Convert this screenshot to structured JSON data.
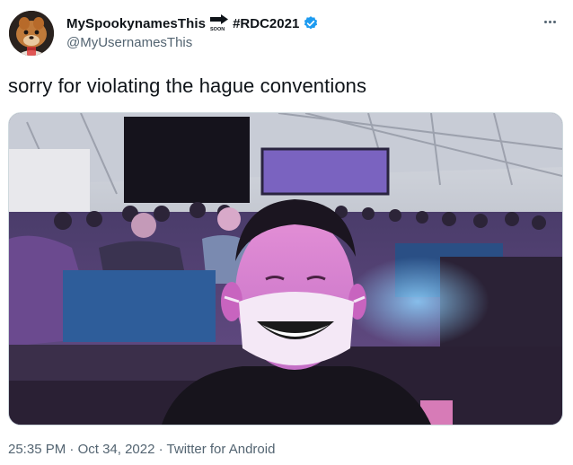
{
  "tweet": {
    "display_name": "MySpookynamesThis",
    "soon_label": "SOON",
    "hashtag": "#RDC2021",
    "username": "@MyUsernamesThis",
    "text": "sorry for violating the hague conventions",
    "time": "25:35 PM",
    "separator": "·",
    "date": "Oct 34, 2022",
    "source": "Twitter for Android"
  },
  "icons": {
    "more": "more-options-icon",
    "verified": "verified-badge-icon",
    "arrow": "arrow-right-icon"
  },
  "colors": {
    "verified": "#1d9bf0",
    "secondary_text": "#536471",
    "primary_text": "#0f1419"
  }
}
